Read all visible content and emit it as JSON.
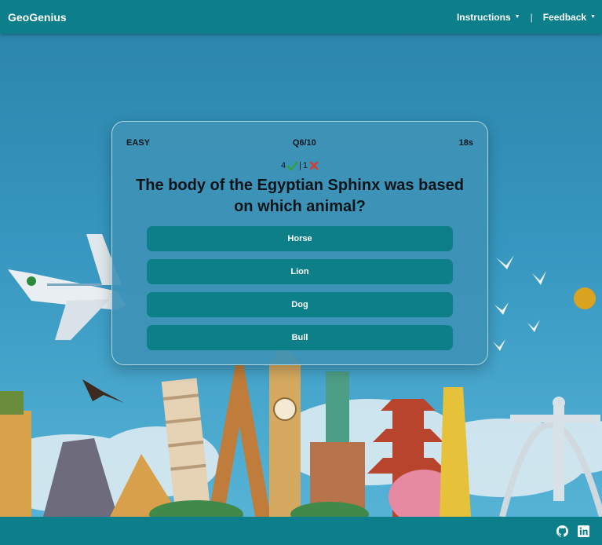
{
  "navbar": {
    "brand": "GeoGenius",
    "instructions_label": "Instructions",
    "separator": "|",
    "feedback_label": "Feedback"
  },
  "quiz": {
    "difficulty": "EASY",
    "progress": "Q6/10",
    "timer": "18s",
    "correct_count": "4",
    "score_separator": "|",
    "wrong_count": "1",
    "question": "The body of the Egyptian Sphinx was based on which animal?",
    "answers": [
      "Horse",
      "Lion",
      "Dog",
      "Bull"
    ]
  },
  "footer": {
    "icons": [
      "github-icon",
      "linkedin-icon"
    ]
  },
  "colors": {
    "navbar": "#0c7f8a",
    "answer_button": "#0d7f88",
    "correct": "#2fa33a",
    "wrong": "#d93a2b"
  }
}
